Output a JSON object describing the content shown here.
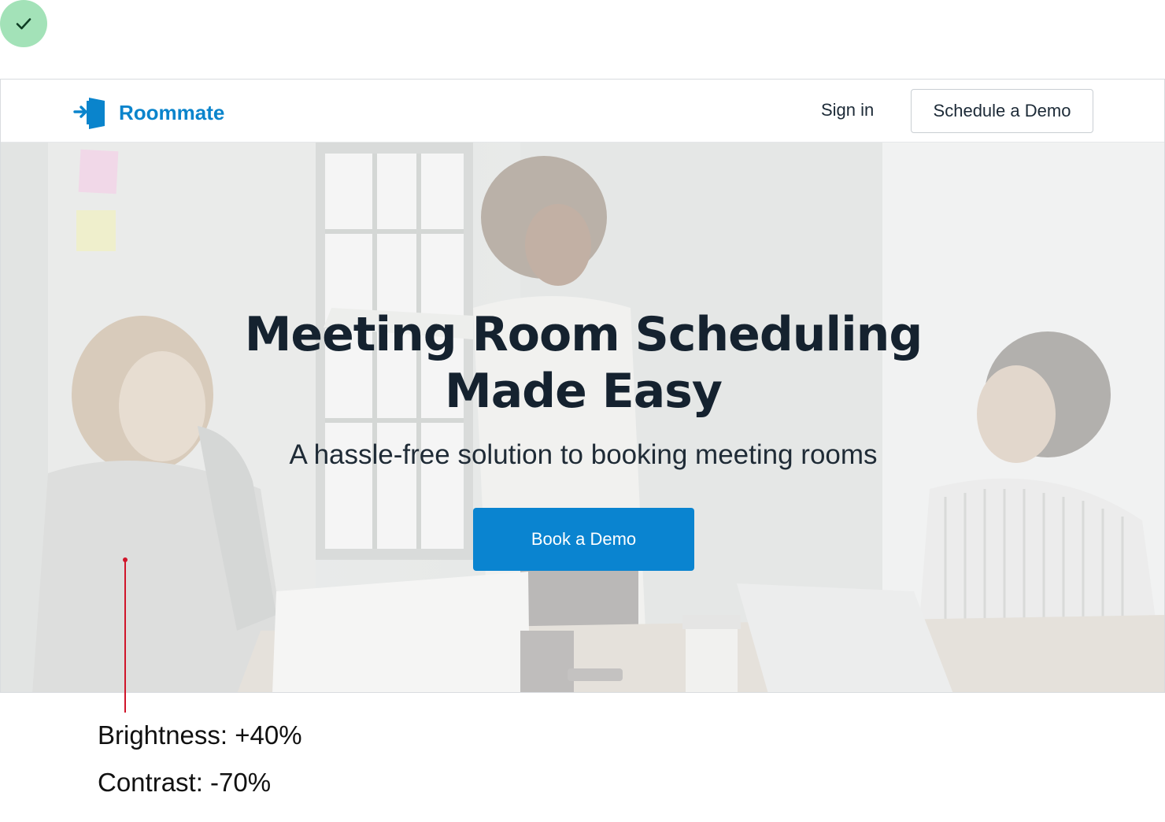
{
  "nav": {
    "brand": "Roommate",
    "sign_in": "Sign in",
    "schedule_demo": "Schedule a Demo"
  },
  "hero": {
    "headline_line1": "Meeting Room Scheduling",
    "headline_line2": "Made Easy",
    "subheadline": "A hassle-free solution to booking meeting rooms",
    "cta": "Book a Demo"
  },
  "annotations": {
    "brightness": "Brightness: +40%",
    "contrast": "Contrast: -70%"
  },
  "icons": {
    "status": "check-icon",
    "logo": "door-enter-icon"
  },
  "colors": {
    "brand_blue": "#0a84cc",
    "cta_blue": "#0a84d0",
    "heading": "#15222f",
    "annotation_red": "#d0152a",
    "check_green": "#a3e2b8"
  }
}
